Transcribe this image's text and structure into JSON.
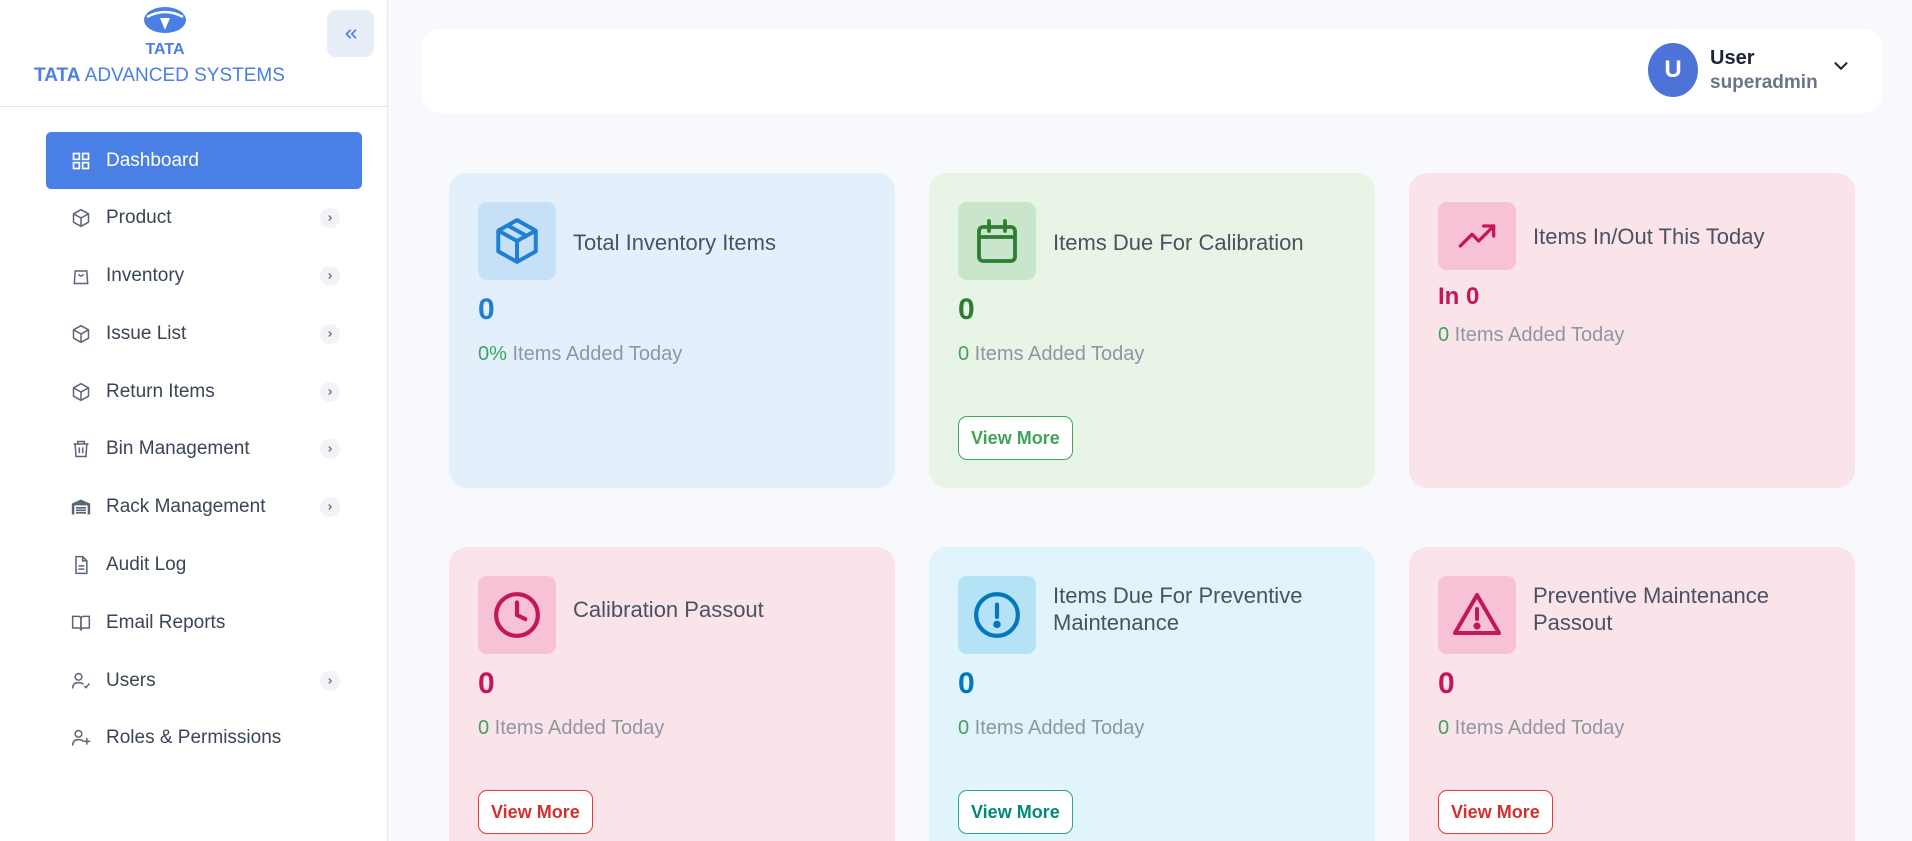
{
  "brand": {
    "logo_word": "TATA",
    "logo_text_bold": "TATA",
    "logo_text_rest": "ADVANCED SYSTEMS"
  },
  "sidebar": {
    "items": [
      {
        "label": "Dashboard",
        "icon": "grid-icon",
        "active": true,
        "has_chevron": false
      },
      {
        "label": "Product",
        "icon": "cube-icon",
        "active": false,
        "has_chevron": true
      },
      {
        "label": "Inventory",
        "icon": "bag-icon",
        "active": false,
        "has_chevron": true
      },
      {
        "label": "Issue List",
        "icon": "cube-icon",
        "active": false,
        "has_chevron": true
      },
      {
        "label": "Return Items",
        "icon": "cube-icon",
        "active": false,
        "has_chevron": true
      },
      {
        "label": "Bin Management",
        "icon": "trash-icon",
        "active": false,
        "has_chevron": true
      },
      {
        "label": "Rack Management",
        "icon": "warehouse-icon",
        "active": false,
        "has_chevron": true
      },
      {
        "label": "Audit Log",
        "icon": "document-icon",
        "active": false,
        "has_chevron": false
      },
      {
        "label": "Email Reports",
        "icon": "book-icon",
        "active": false,
        "has_chevron": false
      },
      {
        "label": "Users",
        "icon": "user-check-icon",
        "active": false,
        "has_chevron": true
      },
      {
        "label": "Roles & Permissions",
        "icon": "user-plus-icon",
        "active": false,
        "has_chevron": false
      }
    ]
  },
  "header": {
    "avatar_initial": "U",
    "user_name": "User",
    "user_role": "superadmin"
  },
  "cards": {
    "total_inventory": {
      "title": "Total Inventory Items",
      "value": "0",
      "sub_highlight": "0%",
      "sub_text": " Items Added Today"
    },
    "due_calibration": {
      "title": "Items Due For Calibration",
      "value": "0",
      "sub_highlight": "0",
      "sub_text": " Items Added Today",
      "button": "View More"
    },
    "in_out_today": {
      "title": "Items In/Out This Today",
      "value": "In 0",
      "sub_highlight": "0",
      "sub_text": " Items Added Today"
    },
    "calibration_passout": {
      "title": "Calibration Passout",
      "value": "0",
      "sub_highlight": "0",
      "sub_text": " Items Added Today",
      "button": "View More"
    },
    "due_preventive": {
      "title": "Items Due For Preventive Maintenance",
      "value": "0",
      "sub_highlight": "0",
      "sub_text": " Items Added Today",
      "button": "View More"
    },
    "preventive_passout": {
      "title": "Preventive Maintenance Passout",
      "value": "0",
      "sub_highlight": "0",
      "sub_text": " Items Added Today",
      "button": "View More"
    }
  },
  "colors": {
    "accent": "#4a7fe6",
    "blue_card": "#e3f0fb",
    "green_card": "#e8f4e6",
    "pink_card": "#fbe3ea",
    "cyan_card": "#e1f3fb"
  }
}
